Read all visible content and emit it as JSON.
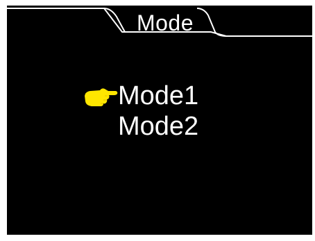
{
  "header": {
    "title": "Mode"
  },
  "menu": {
    "items": [
      {
        "label": "Mode1",
        "selected": true
      },
      {
        "label": "Mode2",
        "selected": false
      }
    ],
    "pointer_icon": "hand-pointing-right-icon"
  },
  "colors": {
    "background": "#000000",
    "text": "#ffffff",
    "pointer": "#ffe600",
    "outer": "#ffffff"
  }
}
